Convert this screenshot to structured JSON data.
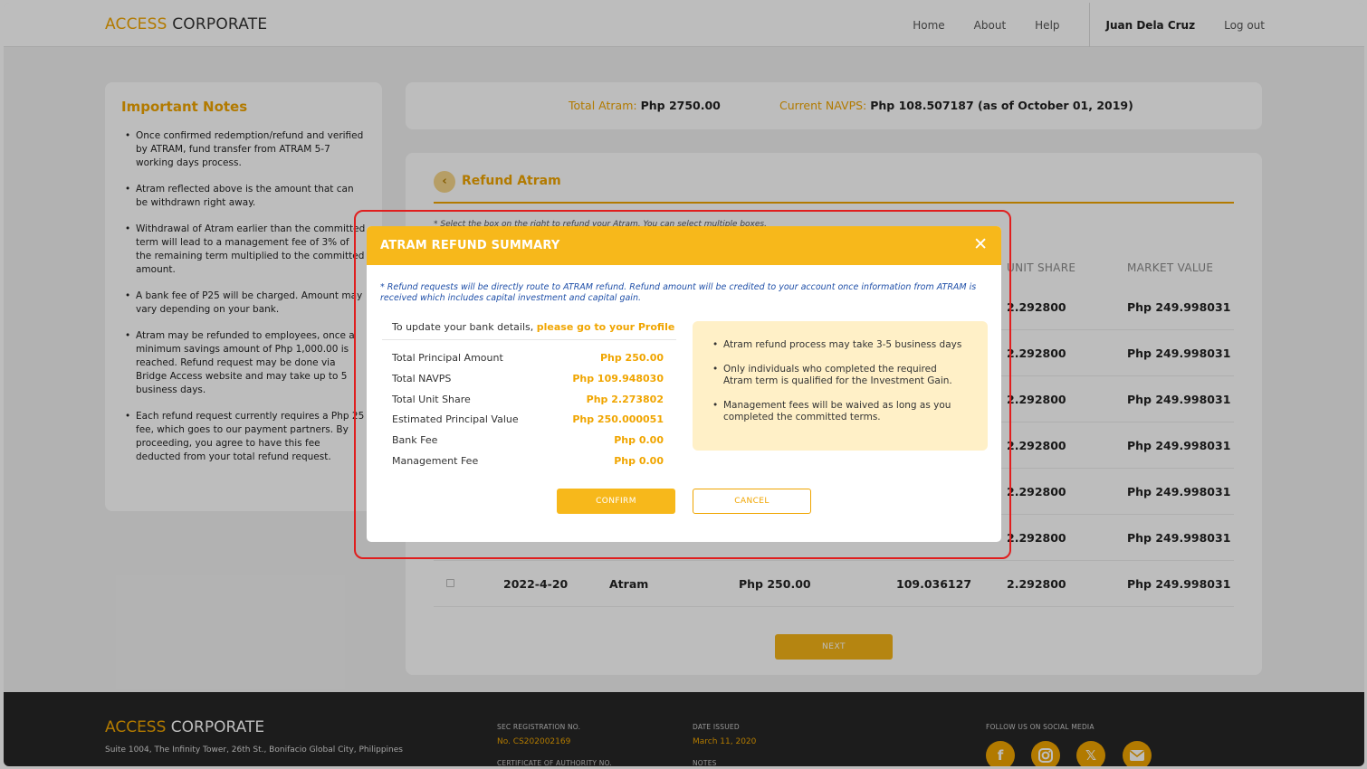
{
  "header": {
    "logo_a": "ACCESS",
    "logo_b": " CORPORATE",
    "nav": [
      "Home",
      "About",
      "Help"
    ],
    "user": "Juan Dela Cruz",
    "logout": "Log out"
  },
  "notes": {
    "title": "Important Notes",
    "items": [
      "Once confirmed redemption/refund and verified by ATRAM, fund transfer from ATRAM 5-7 working days process.",
      "Atram reflected above is the amount that can be withdrawn right away.",
      "Withdrawal of Atram earlier than the committed term will lead to a management fee of 3% of the remaining term multiplied to the committed amount.",
      "A bank fee of P25 will be charged. Amount may vary depending on your bank.",
      "Atram may be refunded to employees, once a minimum savings amount of Php 1,000.00 is reached. Refund request may be done via Bridge Access website and may take up to 5 business days.",
      "Each refund request currently requires a Php 25 fee, which goes to our payment partners. By proceeding, you agree to have this fee deducted from your total refund request."
    ]
  },
  "totals": {
    "atram_label": "Total Atram:",
    "atram_value": "Php 2750.00",
    "navps_label": "Current NAVPS:",
    "navps_value": "Php 108.507187 (as of October 01, 2019)"
  },
  "main": {
    "title": "Refund Atram",
    "hint": "* Select the box on the right to refund your Atram. You can select multiple boxes.",
    "headers": {
      "unit_share": "UNIT SHARE",
      "market_value": "MARKET VALUE"
    },
    "rows": [
      {
        "date": "",
        "type": "",
        "principal": "",
        "navps": "",
        "unit_share": "2.292800",
        "market_value": "Php 249.998031"
      },
      {
        "date": "",
        "type": "",
        "principal": "",
        "navps": "",
        "unit_share": "2.292800",
        "market_value": "Php 249.998031"
      },
      {
        "date": "",
        "type": "",
        "principal": "",
        "navps": "",
        "unit_share": "2.292800",
        "market_value": "Php 249.998031"
      },
      {
        "date": "",
        "type": "",
        "principal": "",
        "navps": "",
        "unit_share": "2.292800",
        "market_value": "Php 249.998031"
      },
      {
        "date": "",
        "type": "",
        "principal": "",
        "navps": "",
        "unit_share": "2.292800",
        "market_value": "Php 249.998031"
      },
      {
        "date": "",
        "type": "",
        "principal": "",
        "navps": "",
        "unit_share": "2.292800",
        "market_value": "Php 249.998031"
      },
      {
        "date": "2022-4-20",
        "type": "Atram",
        "principal": "Php 250.00",
        "navps": "109.036127",
        "unit_share": "2.292800",
        "market_value": "Php 249.998031"
      }
    ],
    "next_label": "NEXT"
  },
  "footer": {
    "logo_a": "ACCESS",
    "logo_b": " CORPORATE",
    "address": "Suite 1004, The Infinity Tower, 26th St., Bonifacio Global City, Philippines",
    "sec_label": "SEC REGISTRATION NO.",
    "sec_value": "No. CS202002169",
    "coa_label": "CERTIFICATE OF AUTHORITY NO.",
    "date_label": "DATE ISSUED",
    "date_value": "March 11, 2020",
    "notes_label": "NOTES",
    "social_label": "FOLLOW US ON SOCIAL MEDIA",
    "social_icons": [
      "facebook-icon",
      "instagram-icon",
      "x-icon",
      "email-icon"
    ]
  },
  "modal": {
    "title": "ATRAM REFUND SUMMARY",
    "close": "✕",
    "note": "* Refund requests will be directly route to ATRAM refund. Refund amount will be credited to your account once information from ATRAM is received which includes capital investment and capital gain.",
    "update_text": "To update your bank details,",
    "update_link": "please go to your Profile",
    "summary": [
      {
        "label": "Total Principal Amount",
        "value": "Php 250.00"
      },
      {
        "label": "Total NAVPS",
        "value": "Php 109.948030"
      },
      {
        "label": "Total Unit Share",
        "value": "Php 2.273802"
      },
      {
        "label": "Estimated Principal Value",
        "value": "Php 250.000051"
      },
      {
        "label": "Bank Fee",
        "value": "Php 0.00"
      },
      {
        "label": "Management Fee",
        "value": "Php 0.00"
      }
    ],
    "info": [
      "Atram refund process may take 3-5 business days",
      "Only individuals who completed the required Atram term is qualified for the Investment Gain.",
      "Management fees will be waived as long as you completed the committed terms."
    ],
    "confirm_label": "CONFIRM",
    "cancel_label": "CANCEL"
  },
  "colors": {
    "accent": "#f0a500",
    "modal_header": "#f7b81b",
    "highlight": "#e01e1e",
    "footer_bg": "#262626"
  }
}
